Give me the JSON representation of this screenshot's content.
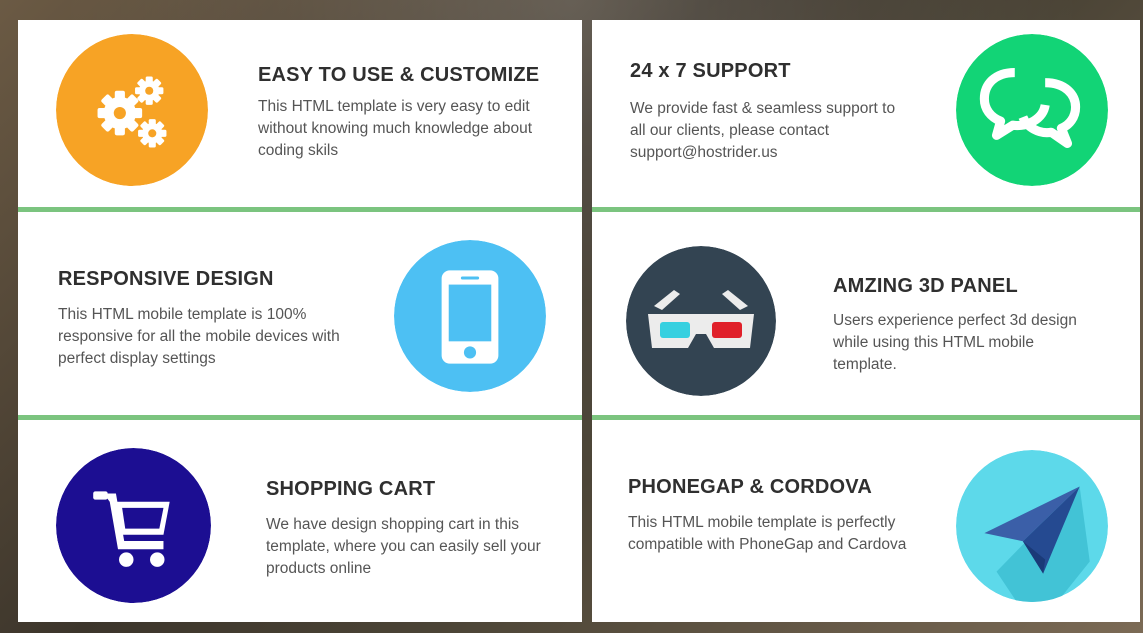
{
  "colors": {
    "divider": "#7bc47f",
    "panel_bg": "#ffffff",
    "title": "#2f2f2f",
    "desc": "#555555"
  },
  "features": [
    {
      "title": "EASY TO USE & CUSTOMIZE",
      "desc": "This HTML template is very easy to edit without knowing much knowledge about coding skils",
      "icon": "gears-icon",
      "color": "#f7a325"
    },
    {
      "title": "24 x 7 SUPPORT",
      "desc": "We provide fast & seamless support to all our clients, please contact support@hostrider.us",
      "icon": "chat-bubbles-icon",
      "color": "#12d476"
    },
    {
      "title": "RESPONSIVE DESIGN",
      "desc": "This HTML mobile template is 100% responsive for all the mobile devices with perfect display settings",
      "icon": "smartphone-icon",
      "color": "#4dc0f3"
    },
    {
      "title": "AMZING 3D PANEL",
      "desc": "Users experience perfect 3d design while using this HTML mobile template.",
      "icon": "3d-glasses-icon",
      "color": "#334452"
    },
    {
      "title": "SHOPPING CART",
      "desc": "We have design shopping cart in this template, where you can easily sell your products online",
      "icon": "shopping-cart-icon",
      "color": "#1c0e92"
    },
    {
      "title": "PHONEGAP & CORDOVA",
      "desc": "This HTML mobile template is perfectly compatible with PhoneGap and Cardova",
      "icon": "paper-plane-icon",
      "color": "#5dd9ea"
    }
  ]
}
